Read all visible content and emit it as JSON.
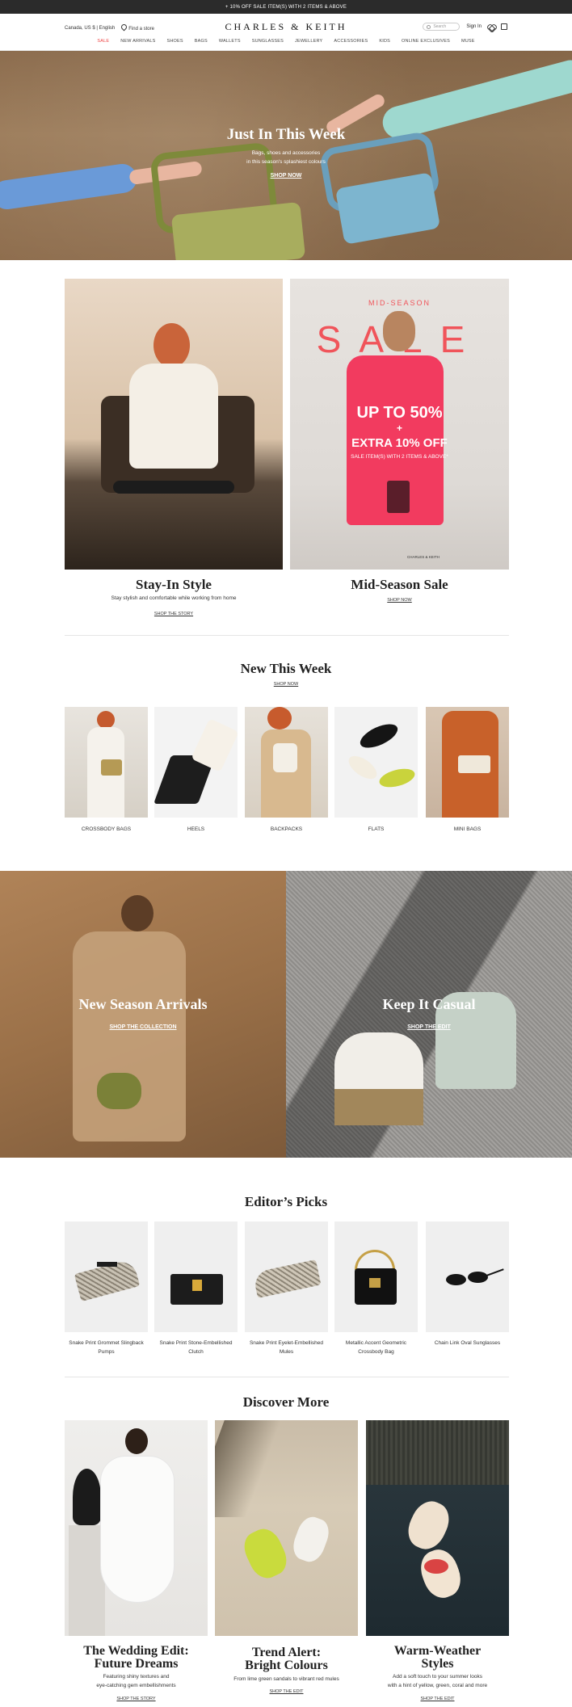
{
  "promo": "+ 10% OFF SALE ITEM(S) WITH 2 ITEMS & ABOVE",
  "header": {
    "locale": "Canada, US $ | English",
    "find_store": "Find a store",
    "logo": "CHARLES & KEITH",
    "search_placeholder": "Search",
    "sign_in": "Sign In"
  },
  "nav": [
    "SALE",
    "NEW ARRIVALS",
    "SHOES",
    "BAGS",
    "WALLETS",
    "SUNGLASSES",
    "JEWELLERY",
    "ACCESSORIES",
    "KIDS",
    "ONLINE EXCLUSIVES",
    "MUSE"
  ],
  "hero": {
    "title": "Just In This Week",
    "line1": "Bags, shoes and accessories",
    "line2": "in this season's splashiest colours",
    "cta": "SHOP NOW"
  },
  "cards": {
    "left": {
      "title": "Stay-In Style",
      "sub": "Stay stylish and comfortable while working from home",
      "link": "SHOP THE STORY"
    },
    "right": {
      "title": "Mid-Season Sale",
      "link": "SHOP NOW",
      "banner_top": "MID-SEASON",
      "banner_big": "SALE",
      "banner_up": "UP TO 50%",
      "banner_plus": "+",
      "banner_extra": "EXTRA 10% OFF",
      "banner_small": "SALE ITEM(S) WITH 2 ITEMS & ABOVE*",
      "banner_brand": "CHARLES & KEITH"
    }
  },
  "new_week": {
    "title": "New This Week",
    "link": "SHOP NOW",
    "items": [
      "CROSSBODY BAGS",
      "HEELS",
      "BACKPACKS",
      "FLATS",
      "MINI BAGS"
    ]
  },
  "split": {
    "left": {
      "title": "New Season Arrivals",
      "link": "SHOP THE COLLECTION"
    },
    "right": {
      "title": "Keep It Casual",
      "link": "SHOP THE EDIT"
    }
  },
  "editors": {
    "title": "Editor’s Picks",
    "items": [
      [
        "Snake Print Grommet Slingback",
        "Pumps"
      ],
      [
        "Snake Print Stone-Embellished",
        "Clutch"
      ],
      [
        "Snake Print Eyelet-Embellished",
        "Mules"
      ],
      [
        "Metallic Accent Geometric",
        "Crossbody Bag"
      ],
      [
        "Chain Link Oval Sunglasses",
        ""
      ]
    ]
  },
  "discover": {
    "title": "Discover More",
    "items": [
      {
        "t1": "The Wedding Edit:",
        "t2": "Future Dreams",
        "s1": "Featuring shiny textures and",
        "s2": "eye-catching gem embellishments",
        "link": "SHOP THE STORY"
      },
      {
        "t1": "Trend Alert:",
        "t2": "Bright Colours",
        "s1": "From lime green sandals to vibrant red mules",
        "s2": "",
        "link": "SHOP THE EDIT"
      },
      {
        "t1": "Warm-Weather",
        "t2": "Styles",
        "s1": "Add a soft touch to your summer looks",
        "s2": "with a hint of yellow, green, coral and more",
        "link": "SHOP THE EDIT"
      }
    ]
  }
}
